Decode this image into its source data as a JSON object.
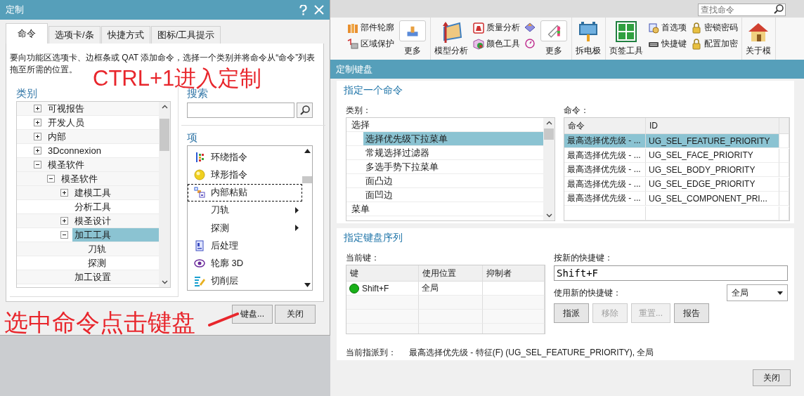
{
  "ribbon": {
    "search": {
      "placeholder": "查找命令"
    },
    "groups": [
      {
        "columns": [
          {
            "kind": "small",
            "items": [
              {
                "label": "部件轮廓"
              },
              {
                "label": "区域保护"
              }
            ]
          },
          {
            "kind": "boxed",
            "label": "更多"
          }
        ]
      },
      {
        "columns": [
          {
            "kind": "large",
            "label": "模型分析"
          },
          {
            "kind": "small",
            "items": [
              {
                "label": "质量分析"
              },
              {
                "label": "颜色工具"
              }
            ]
          },
          {
            "kind": "icons"
          },
          {
            "kind": "boxed",
            "label": "更多"
          }
        ]
      },
      {
        "columns": [
          {
            "kind": "large",
            "label": "拆电极"
          }
        ]
      },
      {
        "columns": [
          {
            "kind": "large",
            "label": "页签工具"
          },
          {
            "kind": "small",
            "items": [
              {
                "label": "首选项"
              },
              {
                "label": "快捷键"
              }
            ]
          },
          {
            "kind": "small",
            "items": [
              {
                "label": "密锁密码"
              },
              {
                "label": "配置加密"
              }
            ]
          }
        ]
      },
      {
        "columns": [
          {
            "kind": "large",
            "label": "关于模"
          }
        ]
      }
    ]
  },
  "left_dialog": {
    "title": "定制",
    "tabs": [
      {
        "label": "命令",
        "selected": true
      },
      {
        "label": "选项卡/条",
        "selected": false
      },
      {
        "label": "快捷方式",
        "selected": false
      },
      {
        "label": "图标/工具提示",
        "selected": false
      }
    ],
    "description": "要向功能区选项卡、边框条或 QAT 添加命令，选择一个类别并将命令从“命令”列表拖至所需的位置。",
    "category_label": "类别",
    "categories": [
      {
        "label": "可视报告",
        "expanded": false,
        "selected": false
      },
      {
        "label": "开发人员",
        "expanded": false,
        "selected": false
      },
      {
        "label": "内部",
        "expanded": false,
        "selected": false
      },
      {
        "label": "3Dconnexion",
        "expanded": false,
        "selected": false
      },
      {
        "label": "模圣软件",
        "expanded": true,
        "selected": false,
        "children": [
          {
            "label": "模圣软件",
            "expanded": true,
            "selected": false,
            "children": [
              {
                "label": "建模工具",
                "expanded": false,
                "selected": false
              },
              {
                "label": "分析工具",
                "selected": false
              },
              {
                "label": "模圣设计",
                "expanded": false,
                "selected": false
              },
              {
                "label": "加工工具",
                "expanded": true,
                "selected": true,
                "children": [
                  {
                    "label": "刀轨",
                    "selected": false
                  },
                  {
                    "label": "探测",
                    "selected": false
                  }
                ]
              },
              {
                "label": "加工设置",
                "selected": false
              }
            ]
          }
        ]
      }
    ],
    "search_label": "搜索",
    "items_label": "项",
    "items": [
      {
        "label": "环绕指令",
        "focused": false,
        "submenu": false
      },
      {
        "label": "球形指令",
        "focused": false,
        "submenu": false
      },
      {
        "label": "内部粘贴",
        "focused": true,
        "submenu": false
      },
      {
        "label": "刀轨",
        "focused": false,
        "submenu": true
      },
      {
        "label": "探测",
        "focused": false,
        "submenu": true
      },
      {
        "label": "后处理",
        "focused": false,
        "submenu": false
      },
      {
        "label": "轮廓 3D",
        "focused": false,
        "submenu": false
      },
      {
        "label": "切削层",
        "focused": false,
        "submenu": false
      }
    ],
    "buttons": [
      {
        "label": "键盘..."
      },
      {
        "label": "关闭"
      }
    ]
  },
  "right_dialog": {
    "title": "定制键盘",
    "command_section": {
      "title": "指定一个命令",
      "category_label": "类别：",
      "categories": [
        {
          "label": "选择",
          "selected": false,
          "children": [
            {
              "label": "选择优先级下拉菜单",
              "selected": true
            },
            {
              "label": "常规选择过滤器",
              "selected": false
            },
            {
              "label": "多选手势下拉菜单",
              "selected": false
            },
            {
              "label": "面凸边",
              "selected": false
            },
            {
              "label": "面凹边",
              "selected": false
            }
          ]
        },
        {
          "label": "菜单",
          "selected": false
        }
      ],
      "command_label": "命令：",
      "columns": [
        "命令",
        "ID"
      ],
      "rows": [
        {
          "command": "最高选择优先级 - ...",
          "id": "UG_SEL_FEATURE_PRIORITY",
          "selected": true
        },
        {
          "command": "最高选择优先级 - ...",
          "id": "UG_SEL_FACE_PRIORITY",
          "selected": false
        },
        {
          "command": "最高选择优先级 - ...",
          "id": "UG_SEL_BODY_PRIORITY",
          "selected": false
        },
        {
          "command": "最高选择优先级 - ...",
          "id": "UG_SEL_EDGE_PRIORITY",
          "selected": false
        },
        {
          "command": "最高选择优先级 - ...",
          "id": "UG_SEL_COMPONENT_PRI...",
          "selected": false
        }
      ]
    },
    "key_section": {
      "title": "指定键盘序列",
      "current_label": "当前键：",
      "columns": [
        "键",
        "使用位置",
        "抑制者"
      ],
      "rows": [
        {
          "key": "Shift+F",
          "scope": "全局"
        }
      ],
      "new_label": "按新的快捷键：",
      "new_value": "Shift+F",
      "use_label": "使用新的快捷键：",
      "scope_value": "全局",
      "buttons": [
        {
          "label": "指派",
          "disabled": false
        },
        {
          "label": "移除",
          "disabled": true
        },
        {
          "label": "重置...",
          "disabled": true
        },
        {
          "label": "报告",
          "disabled": false
        }
      ],
      "assigned_label": "当前指派到：",
      "assigned_value": "最高选择优先级 - 特征(F) (UG_SEL_FEATURE_PRIORITY), 全局"
    },
    "close_button": "关闭"
  },
  "annotations": [
    {
      "text": "CTRL+1进入定制"
    },
    {
      "text": "选中命令点击键盘"
    }
  ]
}
